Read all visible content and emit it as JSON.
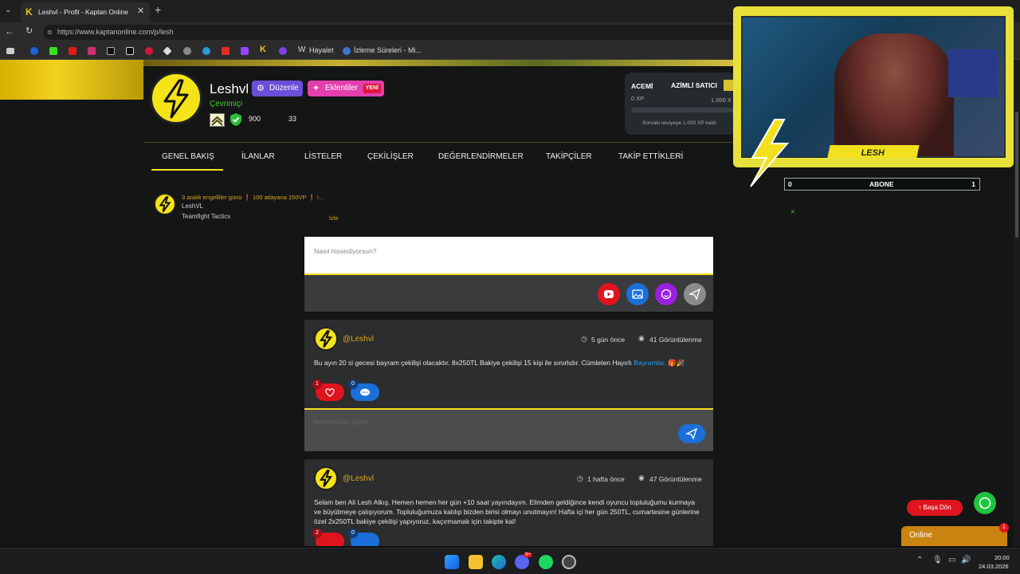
{
  "browser": {
    "tab_title": "Leshvl - Profil - Kaptan Online",
    "url": "https://www.kaptanonline.com/p/lesh",
    "bookmarks": [
      "Hayalet",
      "İzleme Süreleri - Mi..."
    ]
  },
  "profile": {
    "name": "Leshvl",
    "status": "Çevrimiçi",
    "edit_label": "Düzenle",
    "extensions_label": "Eklentiler",
    "new_badge": "YENİ",
    "stat_1": "900",
    "stat_2": "33"
  },
  "level": {
    "current": "ACEMİ",
    "next": "AZİMLİ SATICI",
    "xp": "0 XP",
    "xp_target": "1.000 X",
    "note": "Sonraki seviyeye 1.000 XP kaldı",
    "progress": 0
  },
  "nav": {
    "items": [
      "GENEL BAKIŞ",
      "İLANLAR",
      "LİSTELER",
      "ÇEKİLİŞLER",
      "DEĞERLENDİRMELER",
      "TAKİPÇİLER",
      "TAKİP ETTİKLERİ"
    ],
    "active": 0
  },
  "stream": {
    "title": "3 aralık engelliler günü ❗ 100 atlayana 150VP ❗ !...",
    "channel": "LeshVL",
    "game": "Teamfight Tactics",
    "watch": "İzle"
  },
  "composer": {
    "placeholder": "Nasıl hissediyorsun?"
  },
  "posts": [
    {
      "author": "@Leshvl",
      "time": "5 gün önce",
      "views": "41 Görüntülenme",
      "text": "Bu ayın 20 si gecesi bayram çekilişi olacaktır. 8x250TL Bakiye çekilişi 15 kişi ile sınırlıdır. Cümleten Hayırlı",
      "highlight": "Bayramlar.",
      "likes": "1",
      "comments": "0",
      "comment_placeholder": "Yorumunuzu yazın..."
    },
    {
      "author": "@Leshvl",
      "time": "1 hafta önce",
      "views": "47 Görüntülenme",
      "text": "Selam ben Ali Lesh Alkış. Hemen hemen her gün +10 saat yayındayım. Elimden geldiğince kendi oyuncu topluluğumu kurmaya ve büyütmeye çalışıyorum. Topluluğumuza katılıp bizden birisi olmayı unutmayın! Hafta içi her gün 250TL, cumartesine günlerine özel 2x250TL bakiye çekilişi yapıyoruz, kaçırmamak için takipte kal!",
      "likes": "2",
      "comments": "0"
    }
  ],
  "overlay": {
    "cam_name": "LESH",
    "sub_left": "0",
    "sub_label": "ABONE",
    "sub_right": "1"
  },
  "floating": {
    "back_top": "Başa Dön",
    "online": "Online",
    "online_count": "1"
  },
  "taskbar": {
    "time": "20:00",
    "date": "24.03.2026",
    "badge": "9+"
  },
  "colors": {
    "accent": "#f2e01e",
    "brand_purple": "#6b4fd8",
    "brand_pink": "#e33fae",
    "red": "#e0141e",
    "blue": "#1a6fd8"
  }
}
